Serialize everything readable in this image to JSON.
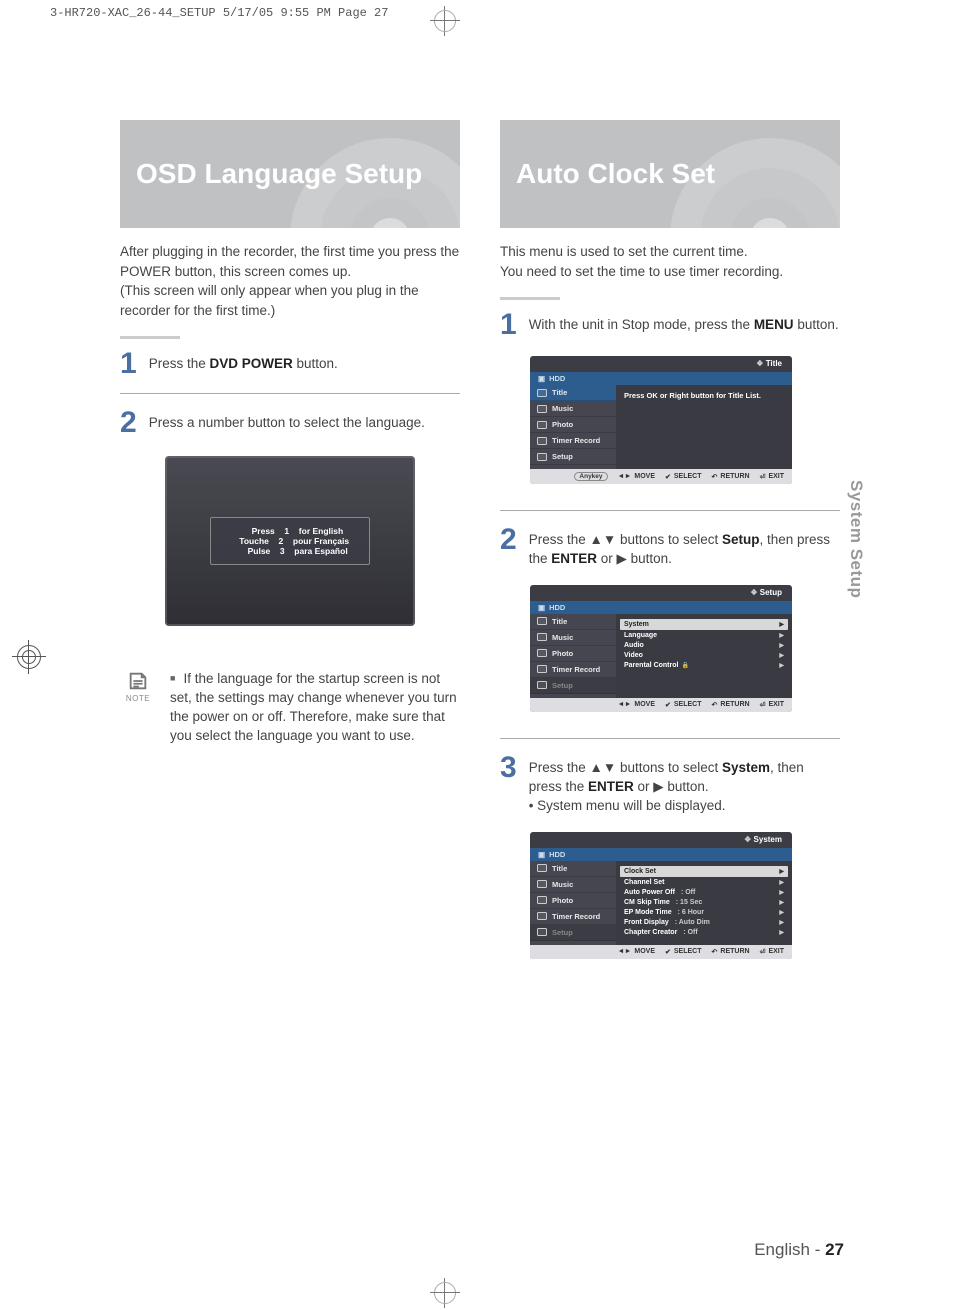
{
  "print_header": "3-HR720-XAC_26-44_SETUP  5/17/05  9:55 PM  Page 27",
  "side_tab": "System Setup",
  "left": {
    "title": "OSD Language Setup",
    "intro": "After plugging in the recorder, the first time you press the POWER button, this screen comes up.\n(This screen will only appear when you plug in the recorder for the first time.)",
    "steps": [
      {
        "num": "1",
        "pre": "Press the ",
        "bold": "DVD POWER",
        "post": " button."
      },
      {
        "num": "2",
        "pre": "Press a number button to select the language.",
        "bold": "",
        "post": ""
      }
    ],
    "osd_lang": [
      {
        "a": "Press",
        "b": "1",
        "c": "for English"
      },
      {
        "a": "Touche",
        "b": "2",
        "c": "pour Français"
      },
      {
        "a": "Pulse",
        "b": "3",
        "c": "para Español"
      }
    ],
    "note_label": "NOTE",
    "note": "If the language for the startup screen is not set, the settings may change whenever you turn the power on or off. Therefore, make sure that you select the language you want to use."
  },
  "right": {
    "title": "Auto Clock Set",
    "intro": "This menu is used to set the current time.\nYou need to set the time to use timer recording.",
    "steps": [
      {
        "num": "1",
        "html": "With the unit in Stop mode, press the <b>MENU</b> button."
      },
      {
        "num": "2",
        "html": "Press the ▲▼ buttons to select <b>Setup</b>, then press the <b>ENTER</b> or ▶ button."
      },
      {
        "num": "3",
        "html": "Press the ▲▼ buttons to select <b>System</b>, then press the <b>ENTER</b> or ▶ button.<br>• System menu will be displayed."
      }
    ],
    "menu_side": [
      "Title",
      "Music",
      "Photo",
      "Timer Record",
      "Setup"
    ],
    "screen1": {
      "header": "Title",
      "hdd": "HDD",
      "selected": 0,
      "msg": "Press OK or Right button for Title List.",
      "footer": {
        "anykey": "Anykey",
        "actions": [
          "MOVE",
          "SELECT",
          "RETURN",
          "EXIT"
        ],
        "syms": [
          "◄►",
          "✔",
          "↶",
          "⏎"
        ]
      }
    },
    "screen2": {
      "header": "Setup",
      "hdd": "HDD",
      "selected": 4,
      "options": [
        {
          "label": "System",
          "sel": true
        },
        {
          "label": "Language"
        },
        {
          "label": "Audio"
        },
        {
          "label": "Video"
        },
        {
          "label": "Parental Control",
          "lock": true
        }
      ],
      "footer": {
        "actions": [
          "MOVE",
          "SELECT",
          "RETURN",
          "EXIT"
        ],
        "syms": [
          "◄►",
          "✔",
          "↶",
          "⏎"
        ]
      }
    },
    "screen3": {
      "header": "System",
      "hdd": "HDD",
      "selected": 4,
      "options": [
        {
          "label": "Clock Set",
          "sel": true
        },
        {
          "label": "Channel Set"
        },
        {
          "label": "Auto Power Off",
          "val": ": Off"
        },
        {
          "label": "CM Skip Time",
          "val": ": 15 Sec"
        },
        {
          "label": "EP Mode Time",
          "val": ": 6 Hour"
        },
        {
          "label": "Front Display",
          "val": ": Auto Dim"
        },
        {
          "label": "Chapter Creator",
          "val": ": Off"
        }
      ],
      "footer": {
        "actions": [
          "MOVE",
          "SELECT",
          "RETURN",
          "EXIT"
        ],
        "syms": [
          "◄►",
          "✔",
          "↶",
          "⏎"
        ]
      }
    }
  },
  "footer": {
    "lang": "English",
    "sep": " - ",
    "page": "27"
  }
}
